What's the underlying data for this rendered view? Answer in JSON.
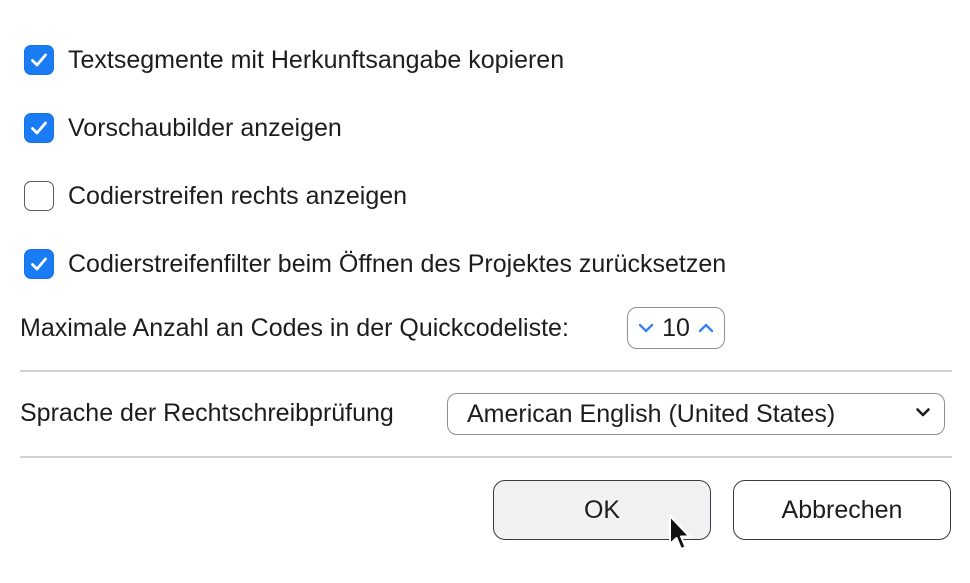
{
  "options": [
    {
      "label": "Textsegmente mit Herkunftsangabe kopieren",
      "checked": true
    },
    {
      "label": "Vorschaubilder anzeigen",
      "checked": true
    },
    {
      "label": "Codierstreifen rechts anzeigen",
      "checked": false
    },
    {
      "label": "Codierstreifenfilter beim Öffnen des Projektes zurücksetzen",
      "checked": true
    }
  ],
  "quickcode": {
    "label": "Maximale Anzahl an Codes in der Quickcodeliste:",
    "value": "10",
    "decrement_icon": "chevron-down-icon",
    "increment_icon": "chevron-up-icon"
  },
  "spellcheck": {
    "label": "Sprache der Rechtschreibprüfung",
    "selected": "American English (United States)",
    "icon": "chevron-down-icon"
  },
  "buttons": {
    "ok_label": "OK",
    "cancel_label": "Abbrechen"
  },
  "colors": {
    "accent": "#1a7cf5",
    "stepper_arrow": "#3b82f6",
    "divider": "#d1d1d6"
  }
}
